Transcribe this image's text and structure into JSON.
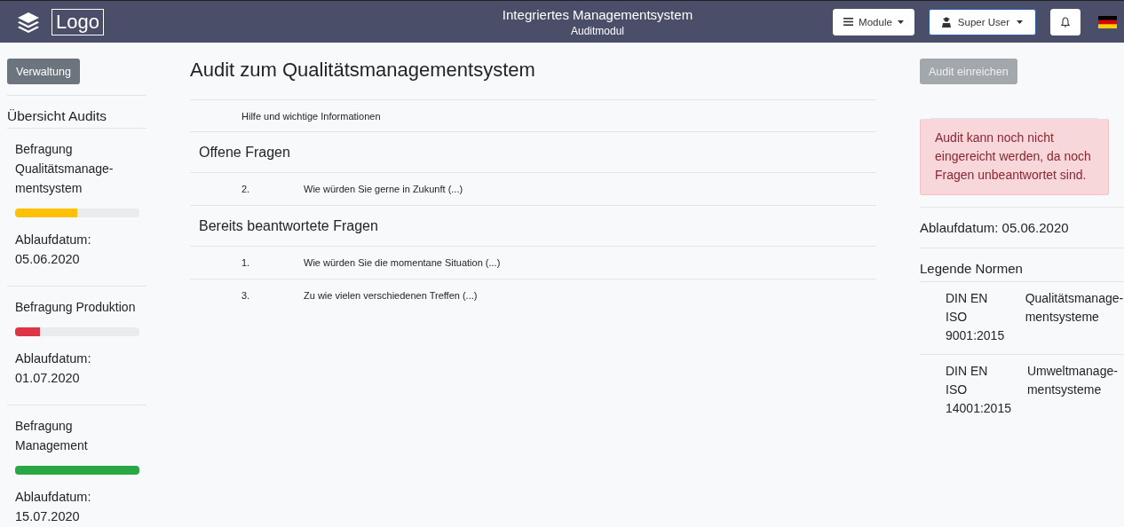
{
  "header": {
    "logo": "Logo",
    "title": "Integriertes Managementsystem",
    "subtitle": "Auditmodul",
    "buttons": [
      {
        "kind": "menu",
        "label": "Module",
        "focused": false
      },
      {
        "kind": "user",
        "label": "Super User",
        "focused": true
      },
      {
        "kind": "bell",
        "focused": false
      }
    ]
  },
  "sidebar": {
    "button": "Verwaltung",
    "heading": "Übersicht Audits",
    "audits": [
      {
        "title": "Befragung Qualitätsmanage-mentsystem",
        "level": 0.5,
        "color": "#ffc107",
        "expiry": "Ablaufdatum: 05.06.2020"
      },
      {
        "title": "Befragung Produktion",
        "level": 0.2,
        "color": "#dc3545",
        "expiry": "Ablaufdatum: 01.07.2020"
      },
      {
        "title": "Befragung Management",
        "level": 1,
        "color": "#28a745",
        "expiry": "Ablaufdatum: 15.07.2020"
      }
    ]
  },
  "main": {
    "title": "Audit zum Qualitätsmanagementsystem",
    "help": "Hilfe und wichtige Informationen",
    "sections": [
      {
        "heading": "Offene Fragen",
        "questions": [
          {
            "number": "2.",
            "text": "Wie würden Sie gerne in Zukunft (...)"
          }
        ]
      },
      {
        "heading": "Bereits beantwortete Fragen",
        "questions": [
          {
            "number": "1.",
            "text": "Wie würden Sie die momentane Situation (...)"
          },
          {
            "number": "3.",
            "text": "Zu wie vielen verschiedenen Treffen (...)"
          }
        ]
      }
    ]
  },
  "aside": {
    "submit": {
      "label": "Audit einreichen",
      "disabled": true
    },
    "alert": "Audit kann noch nicht eingereicht werden, da noch Fragen unbeantwortet sind.",
    "expiry": "Ablaufdatum: 05.06.2020",
    "legend_title": "Legende Normen",
    "norms": [
      {
        "code": "DIN EN ISO 9001:2015",
        "name": "Qualitätsmanage-mentsysteme"
      },
      {
        "code": "DIN EN ISO 14001:2015",
        "name": "Umweltmanage-mentsysteme"
      }
    ]
  }
}
